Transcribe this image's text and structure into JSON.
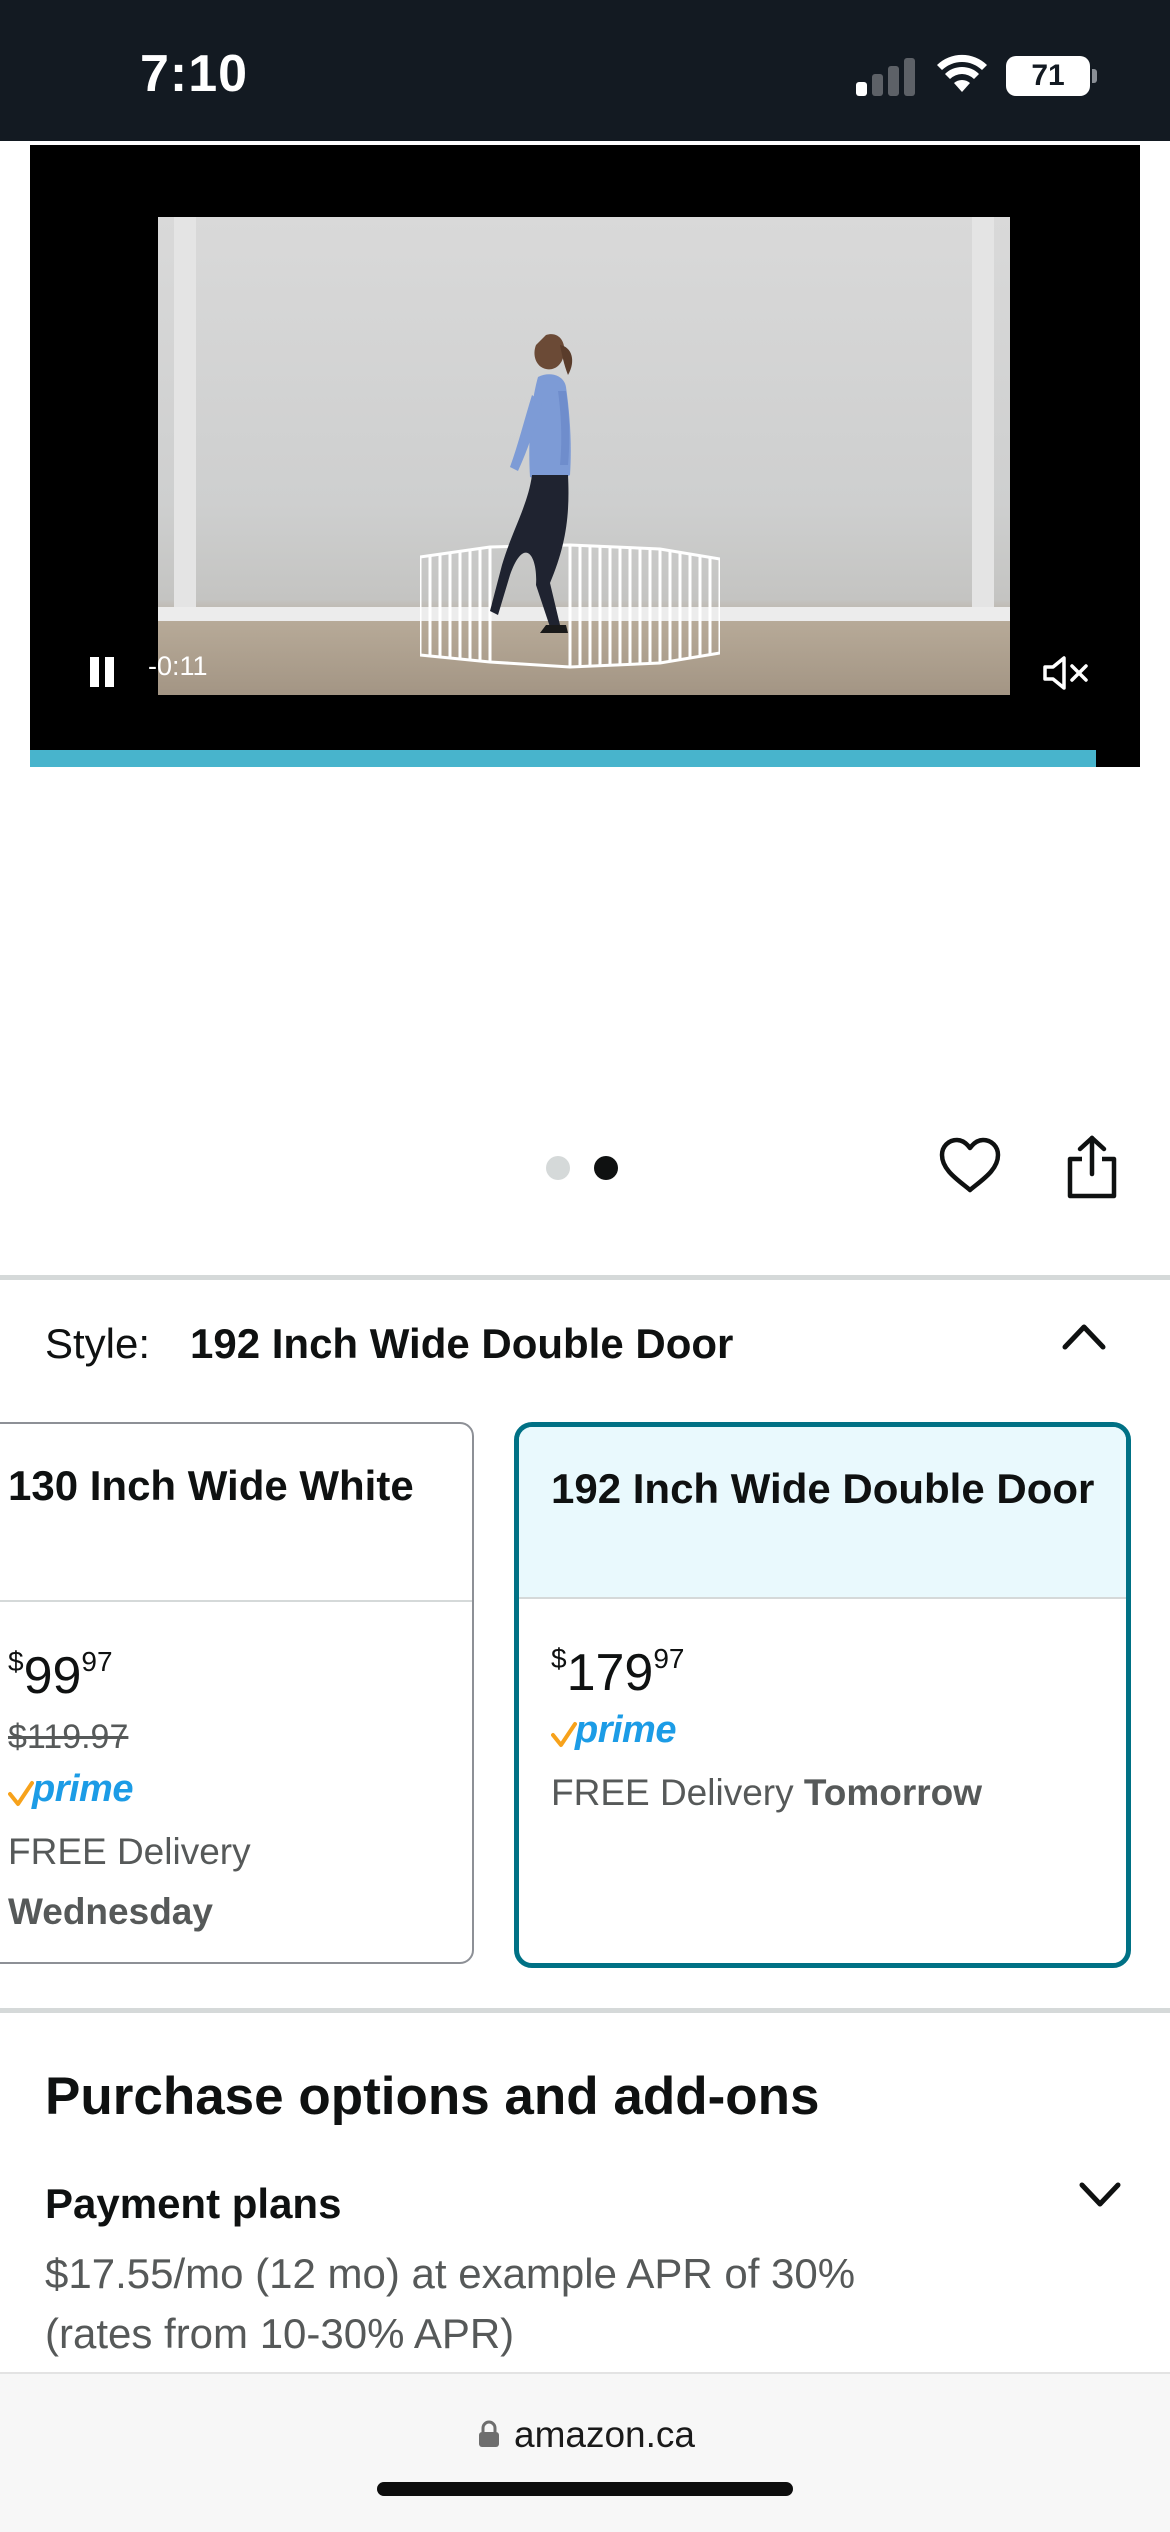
{
  "status_bar": {
    "time": "7:10",
    "battery": "71",
    "signal_icon": "cellular-signal-icon",
    "wifi_icon": "wifi-icon"
  },
  "video": {
    "time_remaining": "-0:11",
    "progress": 0.96,
    "pause_icon": "pause-icon",
    "mute_icon": "speaker-muted-icon",
    "accent_color": "#48b4cc"
  },
  "carousel": {
    "total": 2,
    "active_index": 1
  },
  "actions": {
    "wishlist_icon": "heart-icon",
    "share_icon": "share-icon"
  },
  "style_selector": {
    "label": "Style:",
    "selected": "192 Inch Wide Double Door",
    "options": [
      {
        "title": "130 Inch Wide White",
        "price_symbol": "$",
        "price_whole": "99",
        "price_fraction": "97",
        "was_price": "$119.97",
        "prime": "prime",
        "delivery_text": "FREE Delivery",
        "delivery_day": "Wednesday"
      },
      {
        "title": "192 Inch Wide Double Door",
        "price_symbol": "$",
        "price_whole": "179",
        "price_fraction": "97",
        "prime": "prime",
        "delivery_text": "FREE Delivery",
        "delivery_day": "Tomorrow"
      }
    ],
    "selected_border_color": "#007185"
  },
  "purchase_options": {
    "title": "Purchase options and add-ons",
    "payment_plans_title": "Payment plans",
    "payment_plans_text": "$17.55/mo (12 mo) at example APR of 30% (rates from 10-30% APR)"
  },
  "browser": {
    "url": "amazon.ca",
    "lock_icon": "lock-icon"
  }
}
